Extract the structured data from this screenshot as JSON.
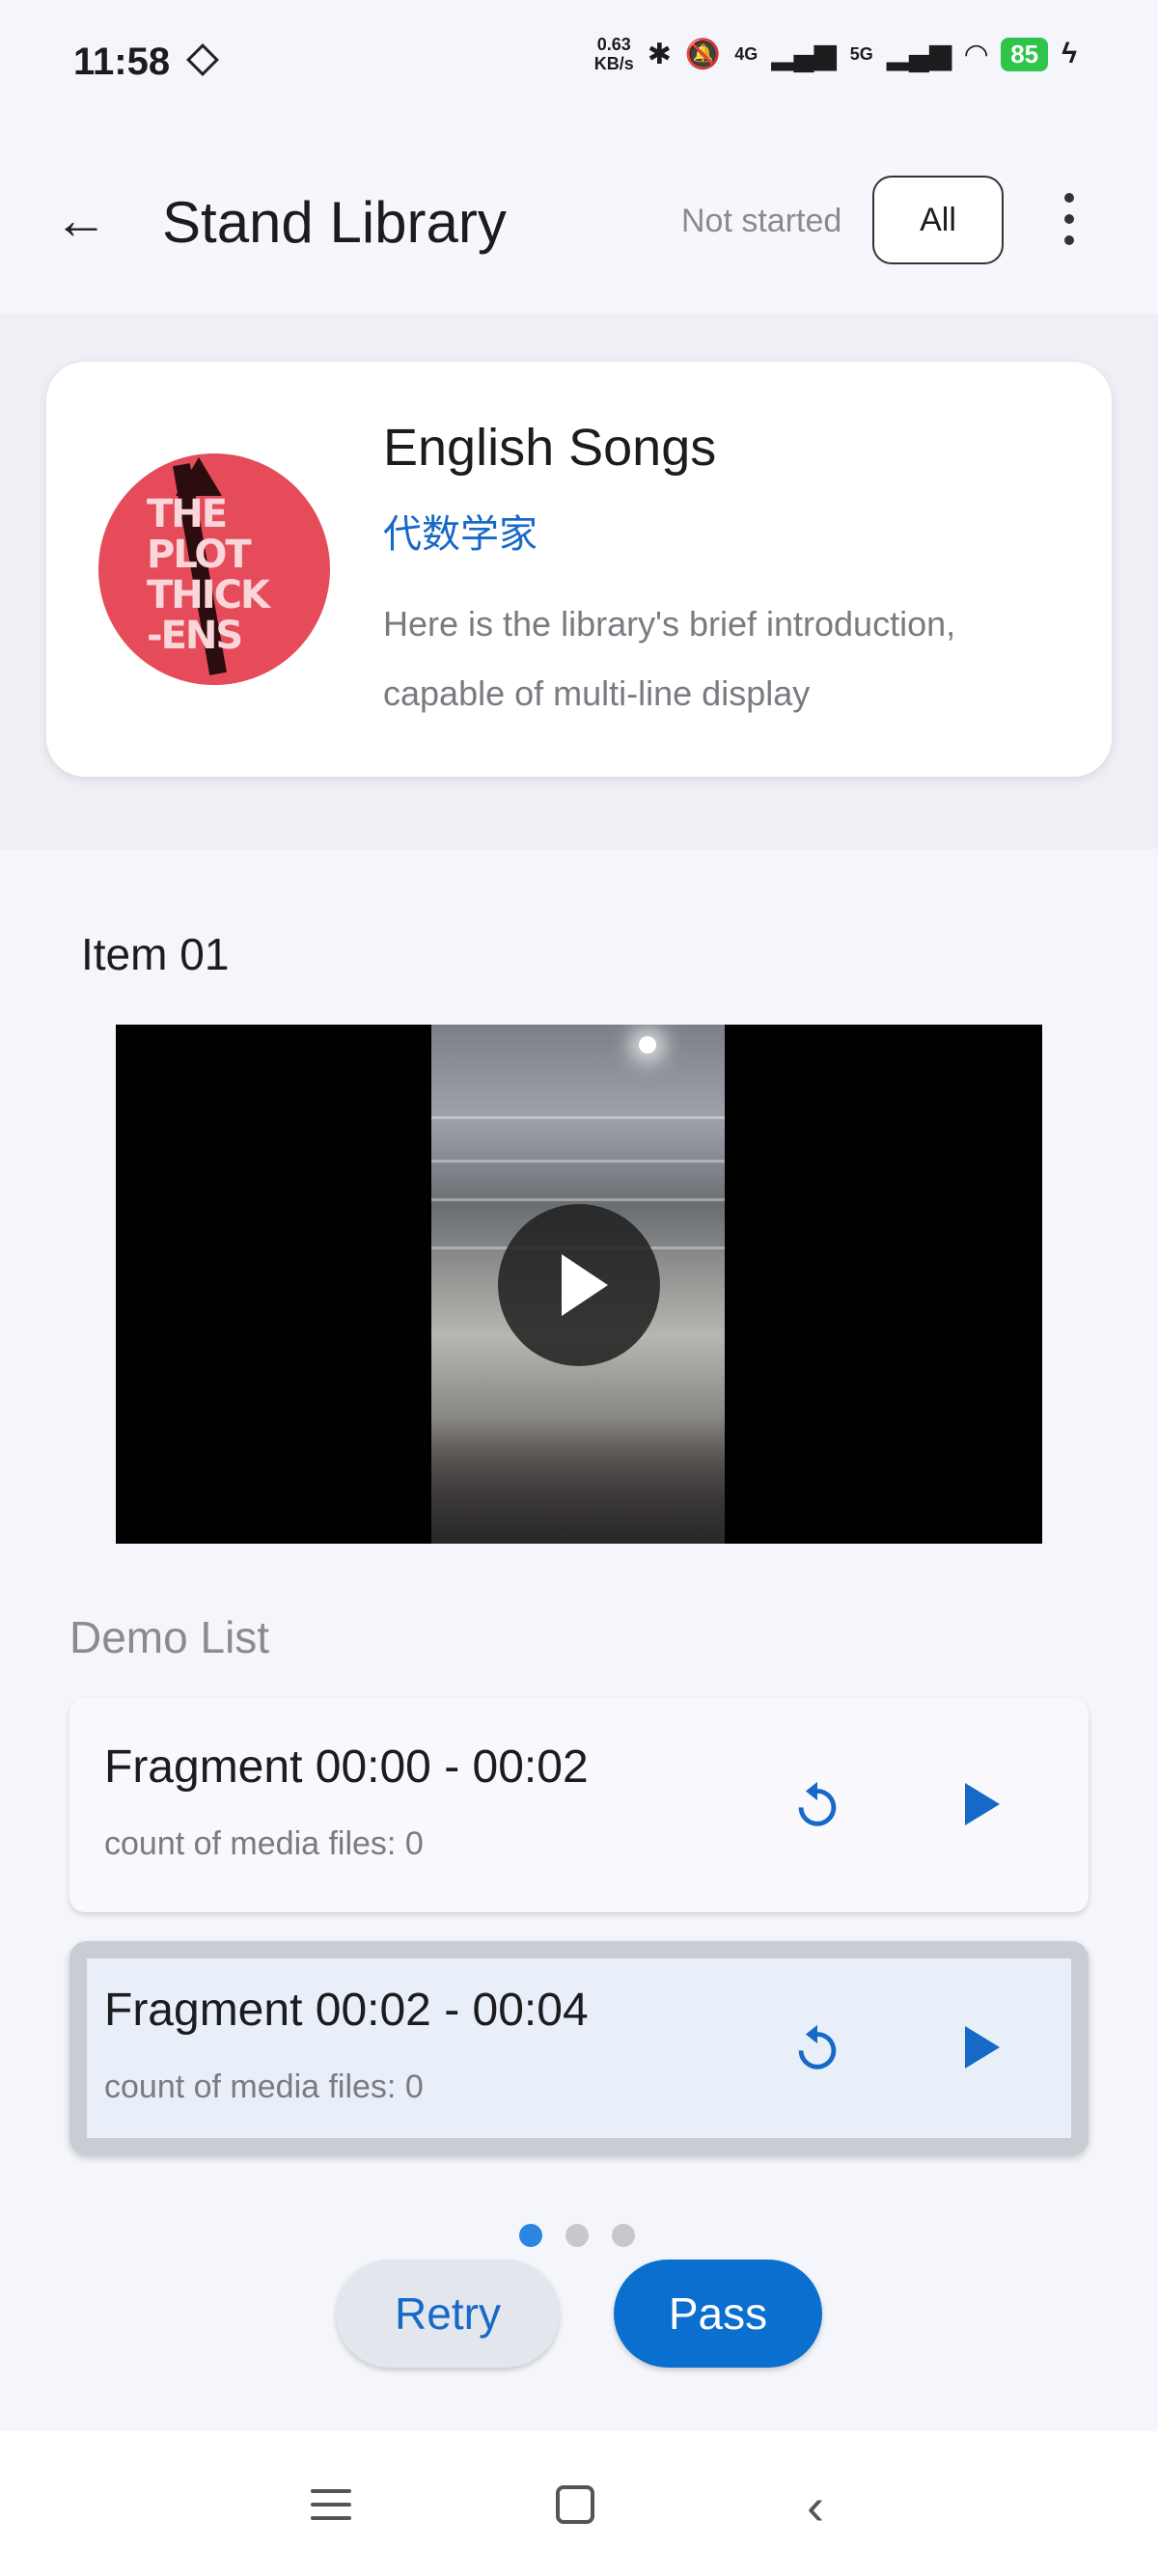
{
  "status_bar": {
    "time": "11:58",
    "net_speed_value": "0.63",
    "net_speed_unit": "KB/s",
    "network_4g": "4G",
    "network_5g": "5G",
    "battery": "85"
  },
  "appbar": {
    "title": "Stand Library",
    "filter_status": "Not started",
    "filter_button": "All"
  },
  "library": {
    "name": "English Songs",
    "author": "代数学家",
    "intro": "Here is the library's brief introduction, capable of multi-line display",
    "cover_text": [
      "THE",
      "PLOT",
      "THICK",
      "-ENS"
    ]
  },
  "item": {
    "title": "Item 01"
  },
  "demo_list": {
    "label": "Demo List",
    "fragments": [
      {
        "name": "Fragment 00:00 - 00:02",
        "count": "count of media files: 0"
      },
      {
        "name": "Fragment 00:02 - 00:04",
        "count": "count of media files: 0"
      }
    ]
  },
  "pager": {
    "total": 3,
    "active": 1
  },
  "actions": {
    "retry": "Retry",
    "pass": "Pass"
  },
  "colors": {
    "accent": "#1769c7",
    "pass_button": "#0b6fcf",
    "battery": "#2fc44a"
  },
  "icons": [
    "back-arrow-icon",
    "more-vert-icon",
    "play-icon",
    "replay-icon",
    "menu-icon",
    "home-icon",
    "nav-back-icon"
  ]
}
